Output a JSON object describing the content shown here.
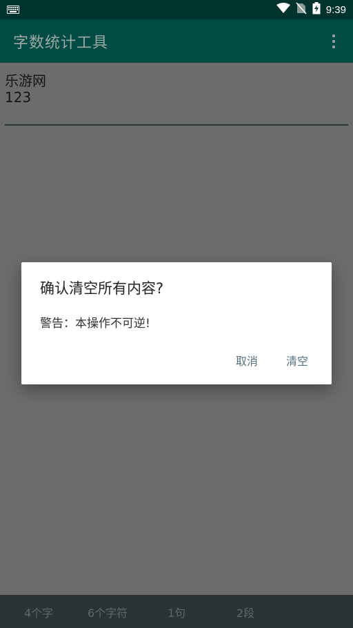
{
  "status_bar": {
    "time": "9:39",
    "icons": [
      "keyboard-icon",
      "wifi-icon",
      "no-sim-icon",
      "battery-charging-icon"
    ]
  },
  "app_bar": {
    "title": "字数统计工具",
    "menu_icon": "overflow-menu-icon"
  },
  "editor": {
    "lines": [
      "乐游网",
      "123"
    ]
  },
  "stats": {
    "chars": "4个字",
    "characters": "6个字符",
    "sentences": "1句",
    "paragraphs": "2段"
  },
  "dialog": {
    "title": "确认清空所有内容?",
    "message": "警告：本操作不可逆!",
    "cancel_label": "取消",
    "confirm_label": "清空"
  },
  "colors": {
    "status_bar": "#00332d",
    "app_bar": "#004b43",
    "scrim_background": "#6c6c6c",
    "bottom_bar": "#2b3336",
    "dialog_button": "#587080"
  }
}
